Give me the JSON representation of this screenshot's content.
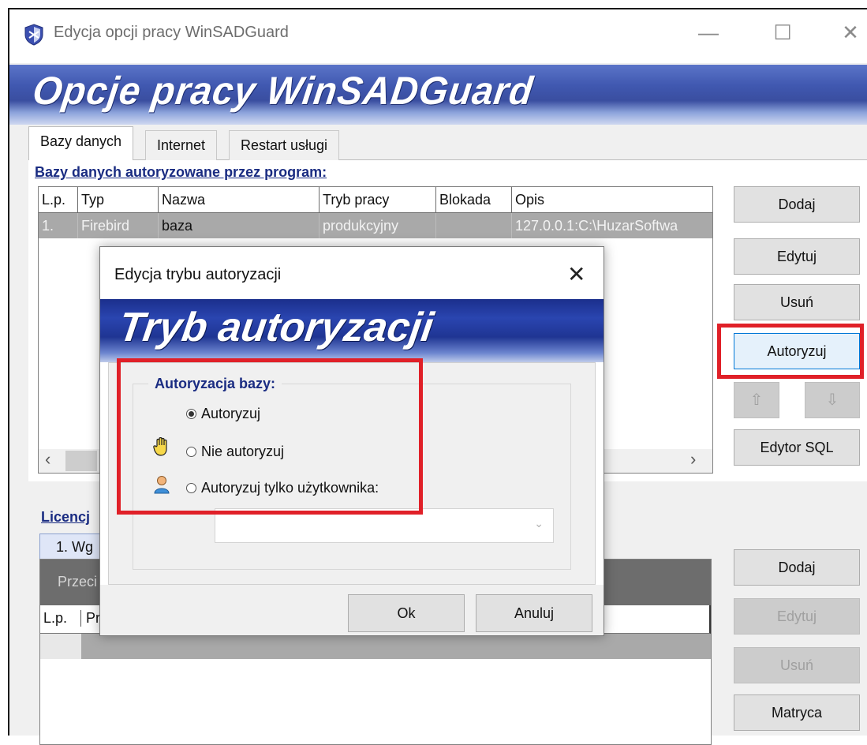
{
  "window": {
    "title": "Edycja opcji pracy WinSADGuard",
    "banner_title": "Opcje pracy WinSADGuard",
    "minimize_glyph": "—",
    "maximize_glyph": "☐",
    "close_glyph": "✕"
  },
  "tabs": [
    {
      "label": "Bazy danych",
      "active": true
    },
    {
      "label": "Internet",
      "active": false
    },
    {
      "label": "Restart usługi",
      "active": false
    }
  ],
  "databases": {
    "heading": "Bazy danych autoryzowane przez program:",
    "columns": [
      "L.p.",
      "Typ",
      "Nazwa",
      "Tryb pracy",
      "Blokada",
      "Opis"
    ],
    "rows": [
      {
        "lp": "1.",
        "typ": "Firebird",
        "nazwa": "baza",
        "tryb": "produkcyjny",
        "blokada": "",
        "opis": "127.0.0.1:C:\\HuzarSoftwa"
      }
    ],
    "scroll_left": "‹",
    "scroll_right": "›"
  },
  "side_buttons": {
    "add": "Dodaj",
    "edit": "Edytuj",
    "delete": "Usuń",
    "authorize": "Autoryzuj",
    "up": "⇧",
    "down": "⇩",
    "sql_editor": "Edytor SQL"
  },
  "licenses": {
    "heading": "Licencj",
    "tab_label": "1. Wg",
    "panel_header": "Przeci",
    "col_lp": "L.p.",
    "col_pr": "Pr"
  },
  "lower_buttons": {
    "add": "Dodaj",
    "edit": "Edytuj",
    "delete": "Usuń",
    "matrix": "Matryca"
  },
  "dialog": {
    "title": "Edycja trybu autoryzacji",
    "close_glyph": "✕",
    "banner_title": "Tryb autoryzacji",
    "group_label": "Autoryzacja bazy:",
    "options": [
      {
        "label": "Autoryzuj",
        "checked": true
      },
      {
        "label": "Nie autoryzuj",
        "checked": false
      },
      {
        "label": "Autoryzuj tylko użytkownika:",
        "checked": false
      }
    ],
    "combo_value": "",
    "combo_arrow": "⌄",
    "ok": "Ok",
    "cancel": "Anuluj"
  },
  "colors": {
    "highlight": "#e02028",
    "heading": "#1a2c82",
    "banner": "#3a4ea0"
  }
}
